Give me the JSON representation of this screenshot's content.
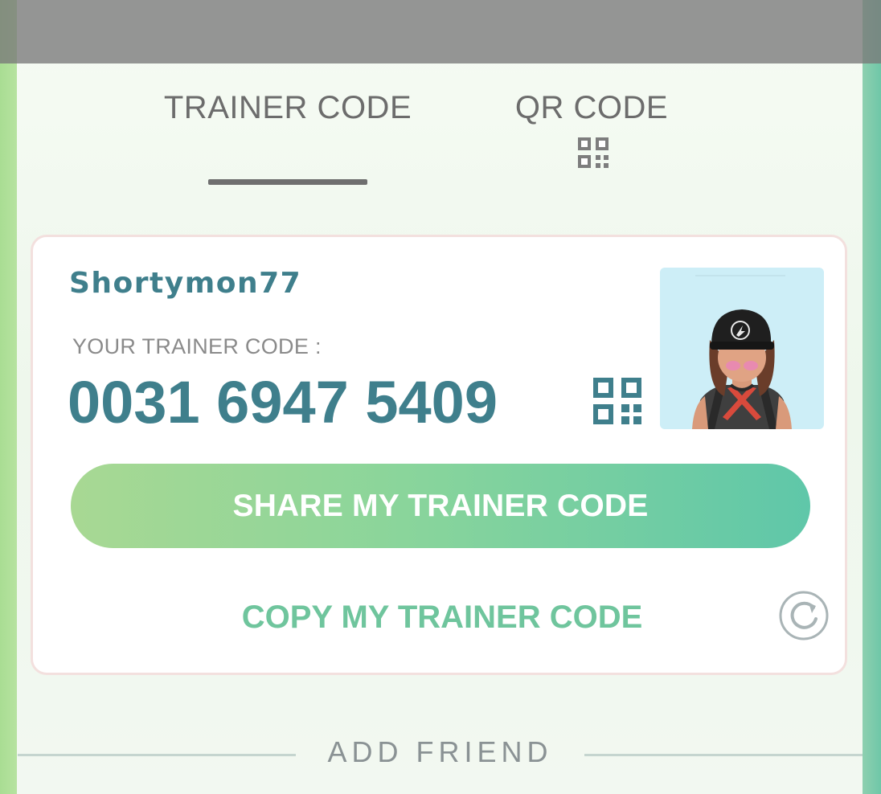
{
  "tabs": [
    {
      "label": "TRAINER CODE",
      "active": true
    },
    {
      "label": "QR CODE",
      "active": false
    }
  ],
  "card": {
    "username": "Shortymon77",
    "code_label": "YOUR TRAINER CODE :",
    "code_value": "0031 6947 5409",
    "share_button_label": "SHARE MY TRAINER CODE",
    "copy_button_label": "COPY MY TRAINER CODE"
  },
  "add_friend": {
    "label": "ADD FRIEND"
  },
  "colors": {
    "accent_teal": "#3f7f8c",
    "button_gradient_start": "#a8d893",
    "button_gradient_end": "#5fc7a9",
    "copy_text": "#6fc59d",
    "tab_text": "#6c6c6c",
    "avatar_background": "#cdeef7"
  },
  "icons": {
    "tab_qr": "qr-code-icon",
    "inline_qr": "qr-code-icon",
    "refresh": "refresh-icon"
  }
}
